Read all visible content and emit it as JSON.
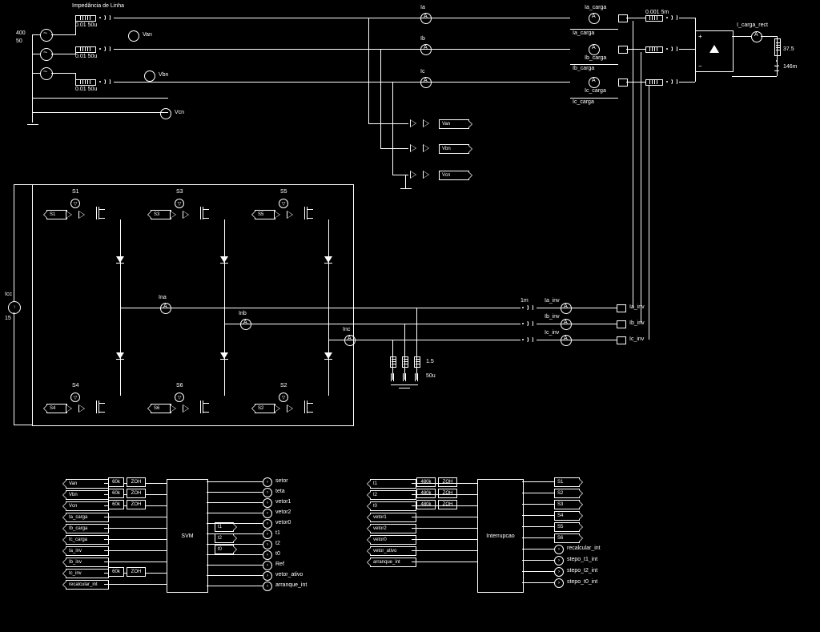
{
  "title_impedance": "Impedância de Linha",
  "source": {
    "v": "400",
    "f": "50"
  },
  "line_z": {
    "r": "0.01",
    "l": "50u"
  },
  "voltages": [
    "Van",
    "Vbn",
    "Vcn"
  ],
  "currents_src": [
    "Ia",
    "Ib",
    "Ic"
  ],
  "currents_load": [
    "Ia_carga",
    "Ib_carga",
    "Ic_carga"
  ],
  "load_line": {
    "r": "0.001",
    "l": "5m"
  },
  "rect": {
    "label": "I_carga_rect",
    "r": "37.5",
    "l": "146m"
  },
  "buffers_out": [
    "Van",
    "Vbn",
    "Vcn"
  ],
  "dc_link": {
    "label": "Icc",
    "val": "15"
  },
  "switches_top": [
    "S1",
    "S3",
    "S5"
  ],
  "switches_bot": [
    "S4",
    "S6",
    "S2"
  ],
  "inv_currents": [
    "Ina",
    "Inb",
    "Inc"
  ],
  "inv_meas": [
    "Ia_inv",
    "Ib_inv",
    "Ic_inv"
  ],
  "inv_L": "1m",
  "filter": {
    "r": "1.5",
    "c": "50u"
  },
  "svm": {
    "name": "SVM",
    "gains": "60k",
    "zoh": "ZOH",
    "in": [
      "Van",
      "Vbn",
      "Vcn",
      "Ia_carga",
      "Ib_carga",
      "Ic_carga",
      "Ia_inv",
      "Ib_inv",
      "Ic_inv",
      "recalcular_int"
    ],
    "mid": [
      "t1",
      "t2",
      "t0"
    ],
    "out": [
      "setor",
      "teta",
      "vetor1",
      "vetor2",
      "vetor0",
      "t1",
      "t2",
      "t0",
      "Ref",
      "vetor_ativo",
      "arranque_int"
    ]
  },
  "intr": {
    "name": "Interrupcao",
    "gains": "480k",
    "in": [
      "t1",
      "t2",
      "t0",
      "vetor1",
      "vetor2",
      "vetor0",
      "vetor_ativo",
      "arranque_int"
    ],
    "out": [
      "S1",
      "S2",
      "S3",
      "S4",
      "S5",
      "S6",
      "recalcular_int",
      "stepo_t1_int",
      "stepo_t2_int",
      "stepo_t0_int"
    ]
  }
}
